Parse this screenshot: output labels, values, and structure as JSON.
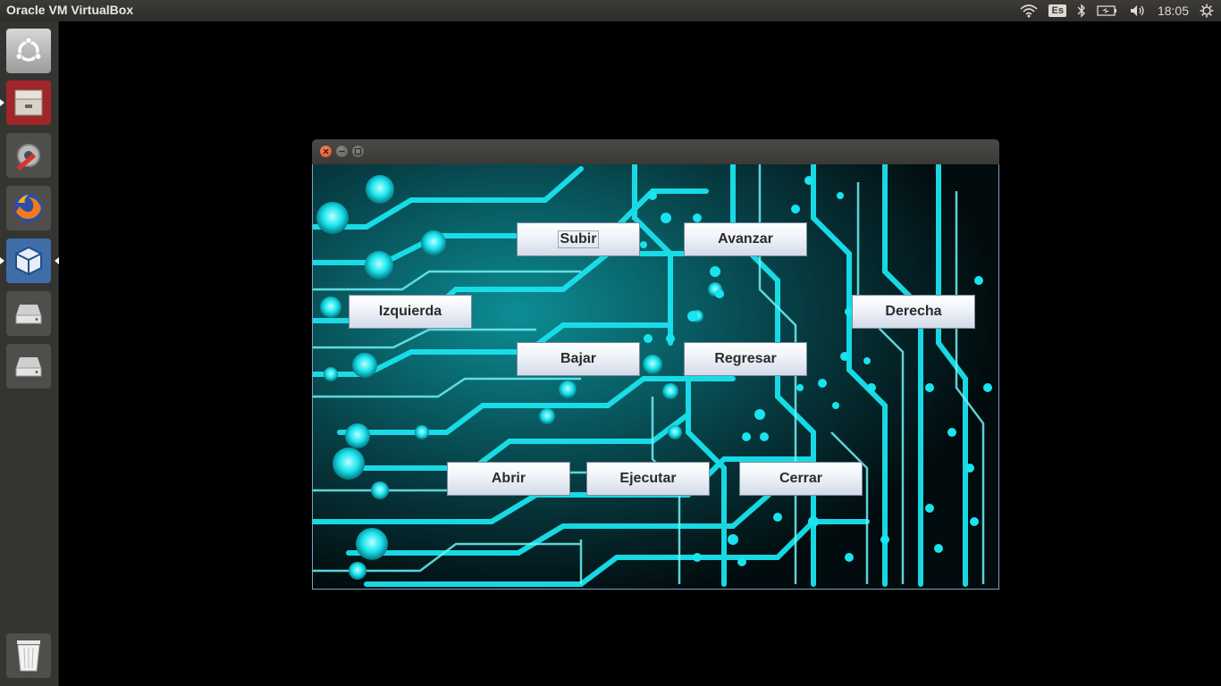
{
  "top_panel": {
    "app_title": "Oracle VM VirtualBox",
    "keyboard_layout": "Es",
    "clock": "18:05",
    "icons": [
      "wifi-icon",
      "keyboard-layout-indicator",
      "bluetooth-icon",
      "battery-icon",
      "volume-icon",
      "settings-gear-icon"
    ]
  },
  "launcher": {
    "items": [
      {
        "name": "ubuntu-dash-icon"
      },
      {
        "name": "files-app-icon"
      },
      {
        "name": "system-settings-icon"
      },
      {
        "name": "firefox-icon"
      },
      {
        "name": "virtualbox-icon"
      },
      {
        "name": "drive-icon-1"
      },
      {
        "name": "drive-icon-2"
      }
    ],
    "trash": "trash-icon"
  },
  "window": {
    "controls": [
      "close-icon",
      "minimize-icon",
      "maximize-icon"
    ],
    "buttons": {
      "subir": "Subir",
      "avanzar": "Avanzar",
      "izquierda": "Izquierda",
      "derecha": "Derecha",
      "bajar": "Bajar",
      "regresar": "Regresar",
      "abrir": "Abrir",
      "ejecutar": "Ejecutar",
      "cerrar": "Cerrar"
    }
  },
  "colors": {
    "panel": "#3c3b37",
    "launcher": "#343431",
    "circuit_cyan": "#19e3ee",
    "circuit_dark": "#031518"
  }
}
